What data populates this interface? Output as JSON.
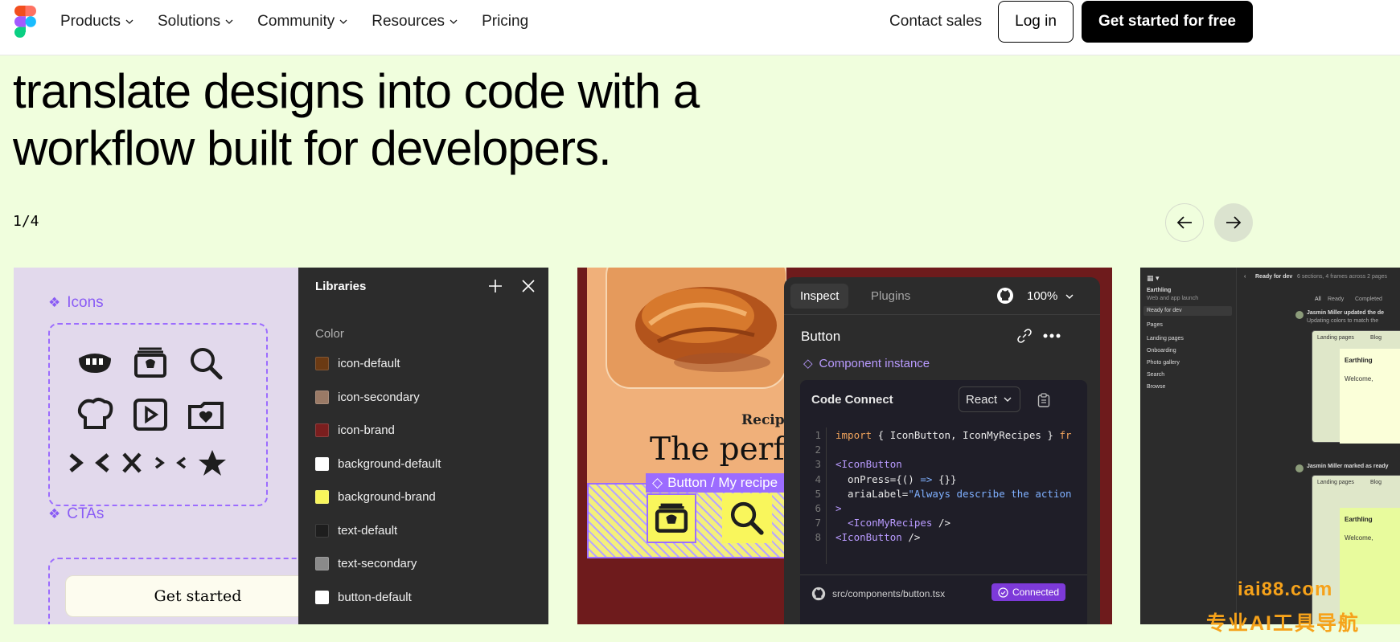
{
  "nav": {
    "links": [
      {
        "label": "Products",
        "has_menu": true
      },
      {
        "label": "Solutions",
        "has_menu": true
      },
      {
        "label": "Community",
        "has_menu": true
      },
      {
        "label": "Resources",
        "has_menu": true
      },
      {
        "label": "Pricing",
        "has_menu": false
      }
    ],
    "contact": "Contact sales",
    "login": "Log in",
    "cta": "Get started for free"
  },
  "hero": {
    "line1": "translate designs into code with a",
    "line2": "workflow built for developers."
  },
  "carousel": {
    "counter": "1/4"
  },
  "card1": {
    "icons_label": "Icons",
    "ctas_label": "CTAs",
    "cta_button": "Get started",
    "libraries": {
      "title": "Libraries",
      "section": "Color",
      "swatches": [
        {
          "name": "icon-default",
          "color": "#6b3a13"
        },
        {
          "name": "icon-secondary",
          "color": "#9a7a66"
        },
        {
          "name": "icon-brand",
          "color": "#7a1e1e"
        },
        {
          "name": "background-default",
          "color": "#ffffff"
        },
        {
          "name": "background-brand",
          "color": "#f9f65c"
        },
        {
          "name": "text-default",
          "color": "#1e1e1e"
        },
        {
          "name": "text-secondary",
          "color": "#8a8a8a"
        },
        {
          "name": "button-default",
          "color": "#ffffff"
        }
      ]
    }
  },
  "card2": {
    "recipe": "Recipe",
    "headline": "The perfe",
    "selection": "Button / My recipe",
    "inspect": {
      "tabs": [
        "Inspect",
        "Plugins"
      ],
      "zoom": "100%",
      "title": "Button",
      "instance": "Component instance",
      "code_connect": "Code Connect",
      "framework": "React",
      "line_numbers": [
        "1",
        "2",
        "3",
        "4",
        "5",
        "6",
        "7",
        "8"
      ],
      "path": "src/components/button.tsx",
      "status": "Connected"
    }
  },
  "card3": {
    "project": "Earthling",
    "subtitle": "Web and app launch",
    "ready": "Ready for dev",
    "pages_label": "Pages",
    "pages": [
      "Landing pages",
      "Onboarding",
      "Photo gallery",
      "Search",
      "Browse"
    ],
    "header": "Ready for dev",
    "header_meta": "6 sections, 4 frames across 2 pages",
    "filters": [
      "All",
      "Ready",
      "Completed"
    ],
    "activity1": "Jasmin Miller updated the de",
    "activity1_sub": "Updating colors to match the",
    "activity2": "Jasmin Miller marked as ready",
    "frame_path": "Landing pages",
    "frame_page": "Blog",
    "frame_title": "Earthling",
    "frame_text": "Welcome,"
  },
  "watermark": {
    "line1": "iai88.com",
    "line2": "专业AI工具导航"
  }
}
